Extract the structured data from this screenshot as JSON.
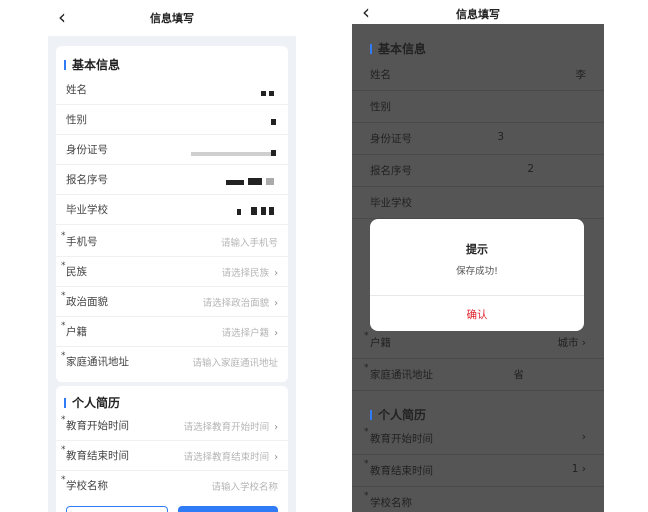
{
  "left": {
    "back_icon": "‹",
    "title": "信息填写",
    "basic_section": "基本信息",
    "basic_fields": [
      {
        "label": "姓名"
      },
      {
        "label": "性别"
      },
      {
        "label": "身份证号"
      },
      {
        "label": "报名序号"
      },
      {
        "label": "毕业学校"
      }
    ],
    "input_fields": [
      {
        "label": "手机号",
        "placeholder": "请输入手机号",
        "chevron": ""
      },
      {
        "label": "民族",
        "placeholder": "请选择民族",
        "chevron": "›"
      },
      {
        "label": "政治面貌",
        "placeholder": "请选择政治面貌",
        "chevron": "›"
      },
      {
        "label": "户籍",
        "placeholder": "请选择户籍",
        "chevron": "›"
      },
      {
        "label": "家庭通讯地址",
        "placeholder": "请输入家庭通讯地址",
        "chevron": ""
      }
    ],
    "resume_section": "个人简历",
    "resume_fields": [
      {
        "label": "教育开始时间",
        "placeholder": "请选择教育开始时间",
        "chevron": "›"
      },
      {
        "label": "教育结束时间",
        "placeholder": "请选择教育结束时间",
        "chevron": "›"
      },
      {
        "label": "学校名称",
        "placeholder": "请输入学校名称",
        "chevron": ""
      }
    ],
    "required_mark": "*"
  },
  "right": {
    "back_icon": "‹",
    "title": "信息填写",
    "basic_section": "基本信息",
    "rows": [
      {
        "label": "姓名",
        "value": "李",
        "req": false
      },
      {
        "label": "性别",
        "value": "",
        "req": false
      },
      {
        "label": "身份证号",
        "value": "3",
        "req": false
      },
      {
        "label": "报名序号",
        "value": "2",
        "req": false
      },
      {
        "label": "毕业学校",
        "value": "",
        "req": false
      }
    ],
    "lower_rows": [
      {
        "label": "户籍",
        "value": "城市 ›",
        "req": true
      },
      {
        "label": "家庭通讯地址",
        "value": "省",
        "req": true
      }
    ],
    "resume_section": "个人简历",
    "resume_rows": [
      {
        "label": "教育开始时间",
        "value": "›",
        "req": true
      },
      {
        "label": "教育结束时间",
        "value": "1 ›",
        "req": true
      },
      {
        "label": "学校名称",
        "value": "",
        "req": true
      }
    ],
    "dialog": {
      "title": "提示",
      "message": "保存成功!",
      "confirm": "确认"
    }
  },
  "colors": {
    "accent": "#2f7cf6",
    "confirm": "#e1242f",
    "overlay": "#555555"
  }
}
